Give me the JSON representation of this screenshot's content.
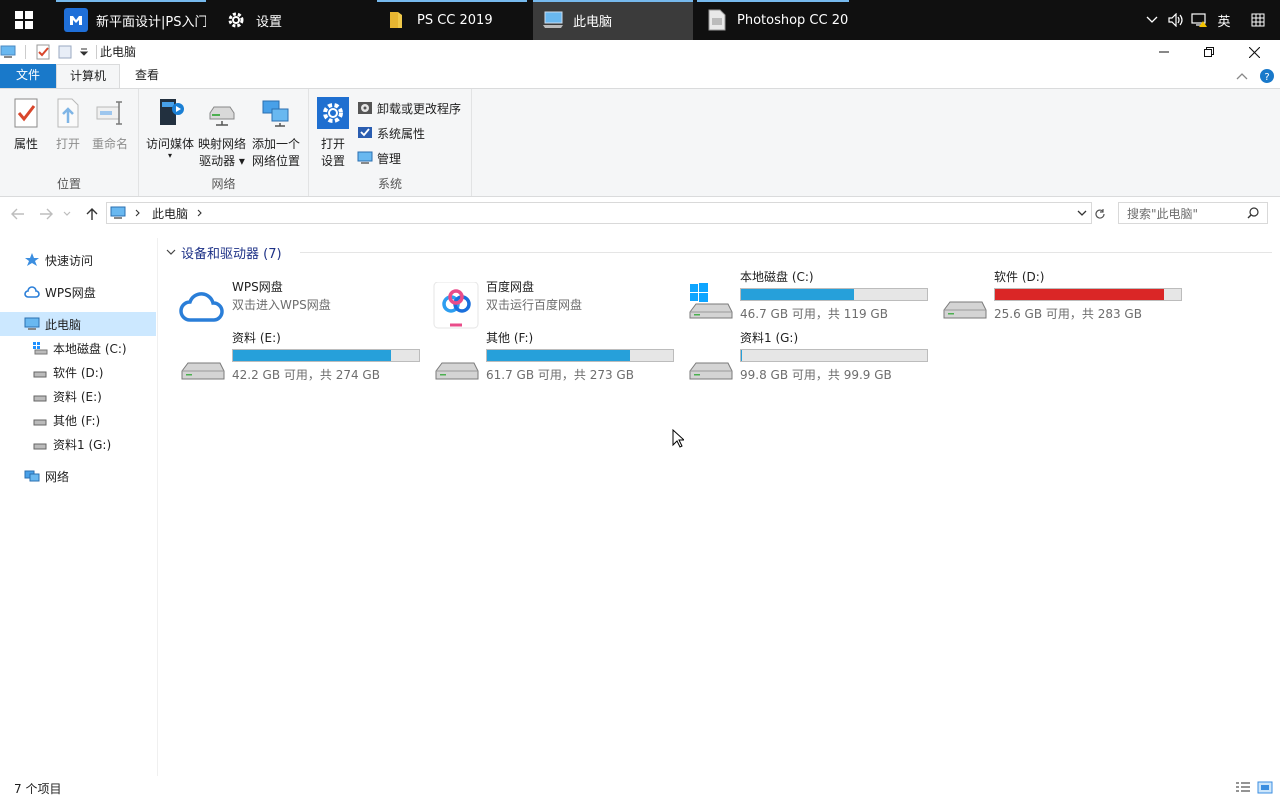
{
  "taskbar": {
    "apps": [
      {
        "label": "新平面设计|PS入门...",
        "icon": "app-logo-icon"
      },
      {
        "label": "设置",
        "icon": "gear-icon"
      },
      {
        "label": "PS CC 2019",
        "icon": "folder-icon"
      },
      {
        "label": "此电脑",
        "icon": "this-pc-icon"
      },
      {
        "label": "Photoshop CC 20...",
        "icon": "photoshop-icon"
      }
    ],
    "tray": {
      "ime": "英"
    }
  },
  "window": {
    "title": "此电脑"
  },
  "ribbon_tabs": {
    "file": "文件",
    "computer": "计算机",
    "view": "查看"
  },
  "ribbon": {
    "location": {
      "label": "位置",
      "properties": "属性",
      "open": "打开",
      "rename": "重命名"
    },
    "network": {
      "label": "网络",
      "access_media": "访问媒体",
      "map_drive_1": "映射网络",
      "map_drive_2": "驱动器",
      "add_location_1": "添加一个",
      "add_location_2": "网络位置"
    },
    "system": {
      "label": "系统",
      "open_settings_1": "打开",
      "open_settings_2": "设置",
      "uninstall": "卸载或更改程序",
      "system_properties": "系统属性",
      "manage": "管理"
    }
  },
  "address": {
    "path": "此电脑",
    "search_placeholder": "搜索\"此电脑\""
  },
  "nav": [
    {
      "label": "快速访问",
      "icon": "star-icon"
    },
    {
      "label": "WPS网盘",
      "icon": "cloud-icon"
    },
    {
      "label": "此电脑",
      "icon": "this-pc-icon"
    },
    {
      "label": "本地磁盘 (C:)",
      "icon": "drive-icon"
    },
    {
      "label": "软件 (D:)",
      "icon": "drive-icon"
    },
    {
      "label": "资料 (E:)",
      "icon": "drive-icon"
    },
    {
      "label": "其他 (F:)",
      "icon": "drive-icon"
    },
    {
      "label": "资料1 (G:)",
      "icon": "drive-icon"
    },
    {
      "label": "网络",
      "icon": "network-icon"
    }
  ],
  "content": {
    "group_title": "设备和驱动器 (7)",
    "items": [
      {
        "name": "WPS网盘",
        "sub": "双击进入WPS网盘"
      },
      {
        "name": "百度网盘",
        "sub": "双击运行百度网盘"
      },
      {
        "name": "本地磁盘 (C:)",
        "sub": "46.7 GB 可用，共 119 GB",
        "used_fraction": 0.61
      },
      {
        "name": "软件 (D:)",
        "sub": "25.6 GB 可用，共 283 GB",
        "used_fraction": 0.91
      },
      {
        "name": "资料 (E:)",
        "sub": "42.2 GB 可用，共 274 GB",
        "used_fraction": 0.85
      },
      {
        "name": "其他 (F:)",
        "sub": "61.7 GB 可用，共 273 GB",
        "used_fraction": 0.77
      },
      {
        "name": "资料1 (G:)",
        "sub": "99.8 GB 可用，共 99.9 GB",
        "used_fraction": 0.001
      }
    ]
  },
  "status": {
    "count": "7 个项目"
  },
  "colors": {
    "accent": "#1979ca",
    "bar_normal": "#26a0da",
    "bar_full": "#da2626",
    "selection": "#cce8ff"
  }
}
